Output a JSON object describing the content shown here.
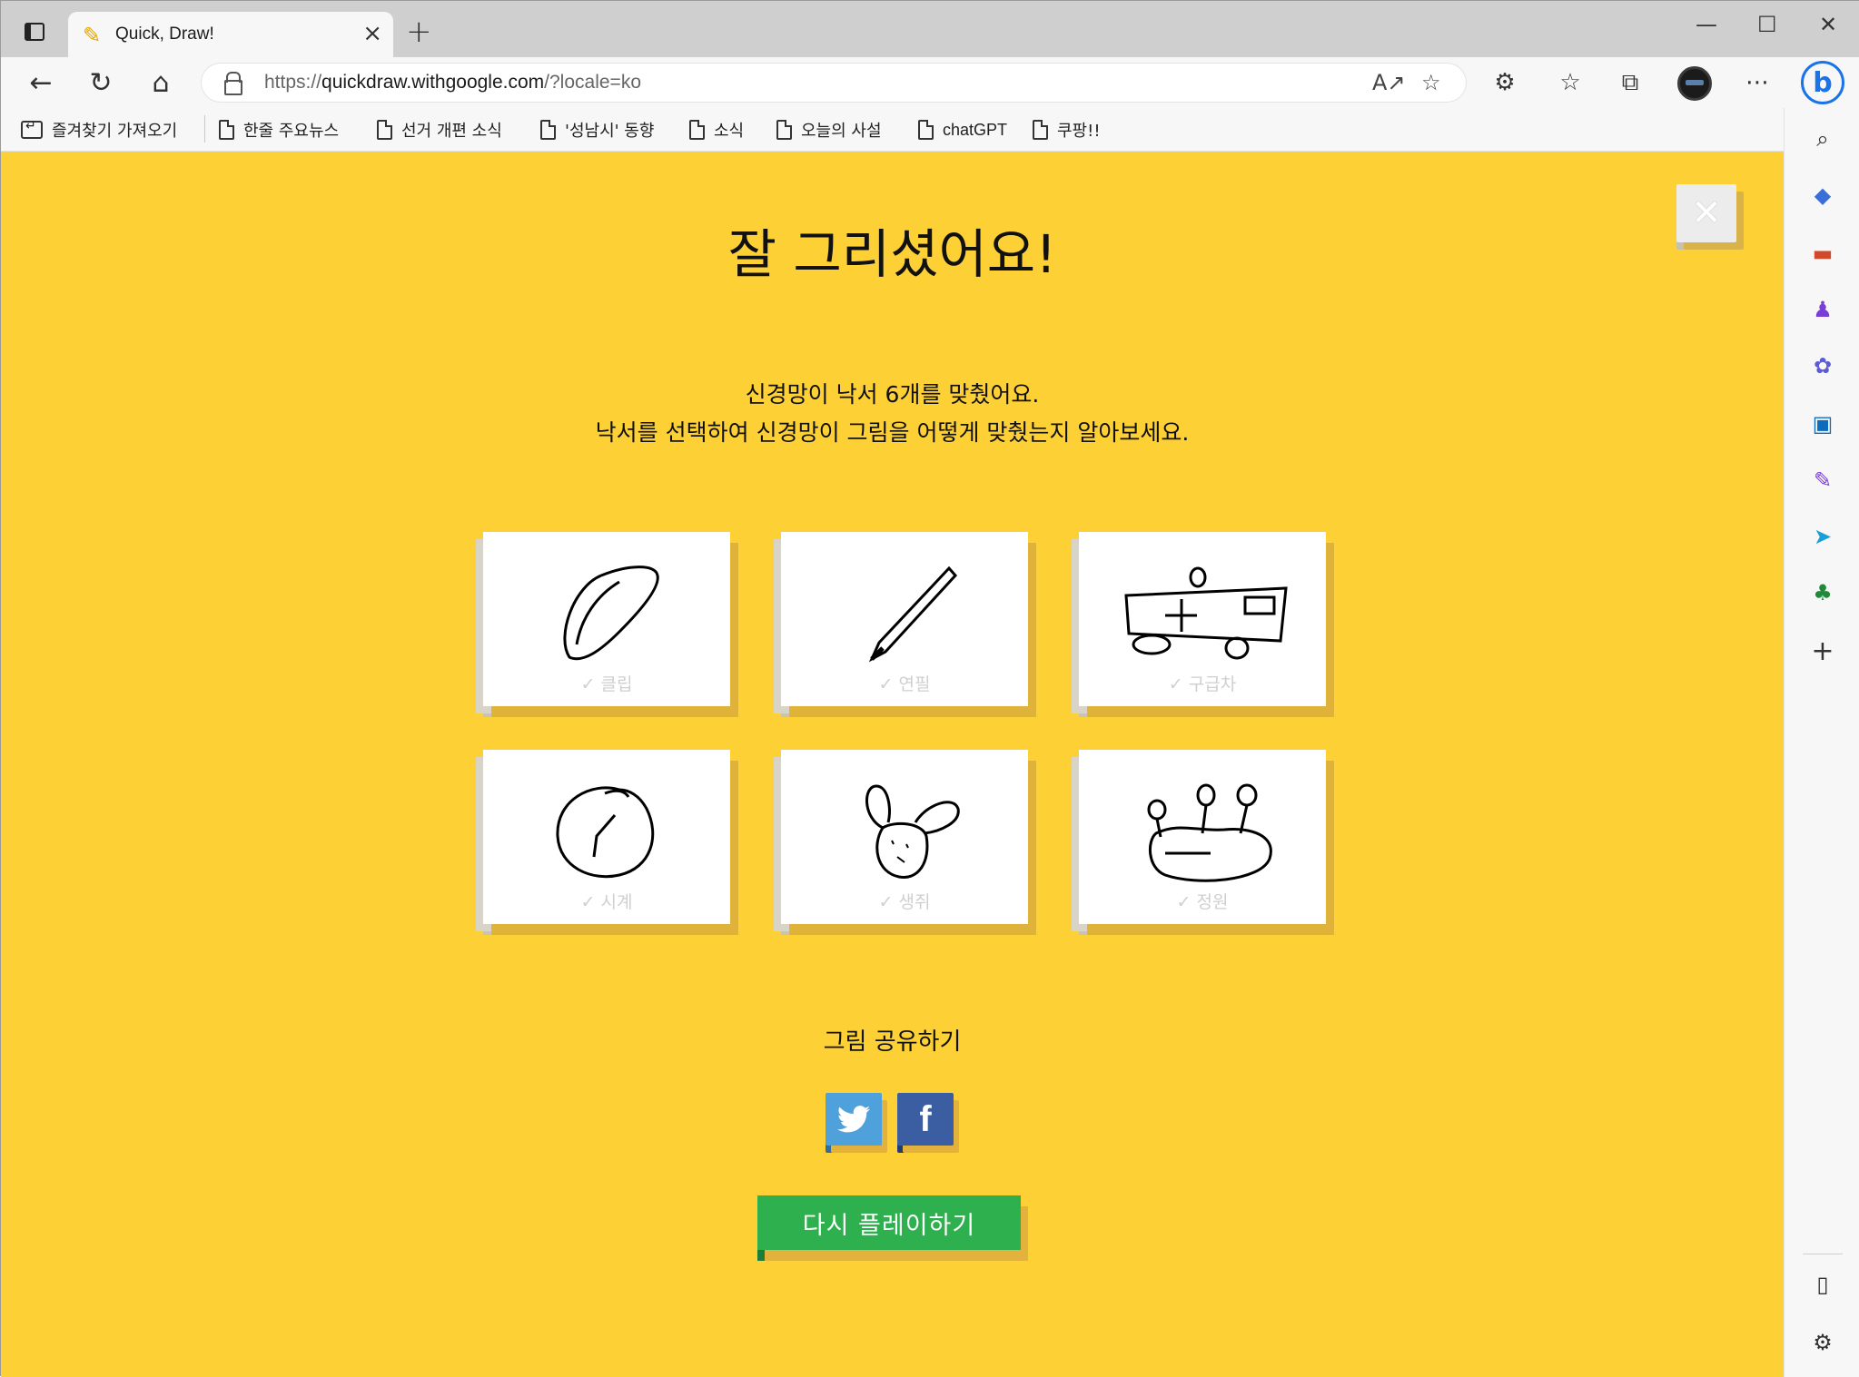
{
  "browser": {
    "tab_title": "Quick, Draw!",
    "url_prefix": "https://",
    "url_main": "quickdraw.withgoogle.com",
    "url_query": "/?locale=ko",
    "favorites": [
      "즐겨찾기 가져오기",
      "한줄 주요뉴스",
      "선거 개편 소식",
      "'성남시' 동향",
      "소식",
      "오늘의 사설",
      "chatGPT",
      "쿠팡!!"
    ]
  },
  "page": {
    "title": "잘 그리셨어요!",
    "message_line1": "신경망이 낙서 6개를 맞췄어요.",
    "message_line2": "낙서를 선택하여 신경망이 그림을 어떻게 맞췄는지 알아보세요.",
    "drawings": [
      {
        "label": "✓ 클립",
        "icon": "paperclip-doodle"
      },
      {
        "label": "✓ 연필",
        "icon": "pencil-doodle"
      },
      {
        "label": "✓ 구급차",
        "icon": "ambulance-doodle"
      },
      {
        "label": "✓ 시계",
        "icon": "clock-doodle"
      },
      {
        "label": "✓ 생쥐",
        "icon": "mouse-doodle"
      },
      {
        "label": "✓ 정원",
        "icon": "garden-doodle"
      }
    ],
    "share_label": "그림 공유하기",
    "replay_label": "다시  플레이하기",
    "facebook_glyph": "f"
  },
  "colors": {
    "background": "#fdd035",
    "replay_button": "#2fb04e",
    "twitter": "#4fa1dc",
    "facebook": "#3b5ea3"
  }
}
